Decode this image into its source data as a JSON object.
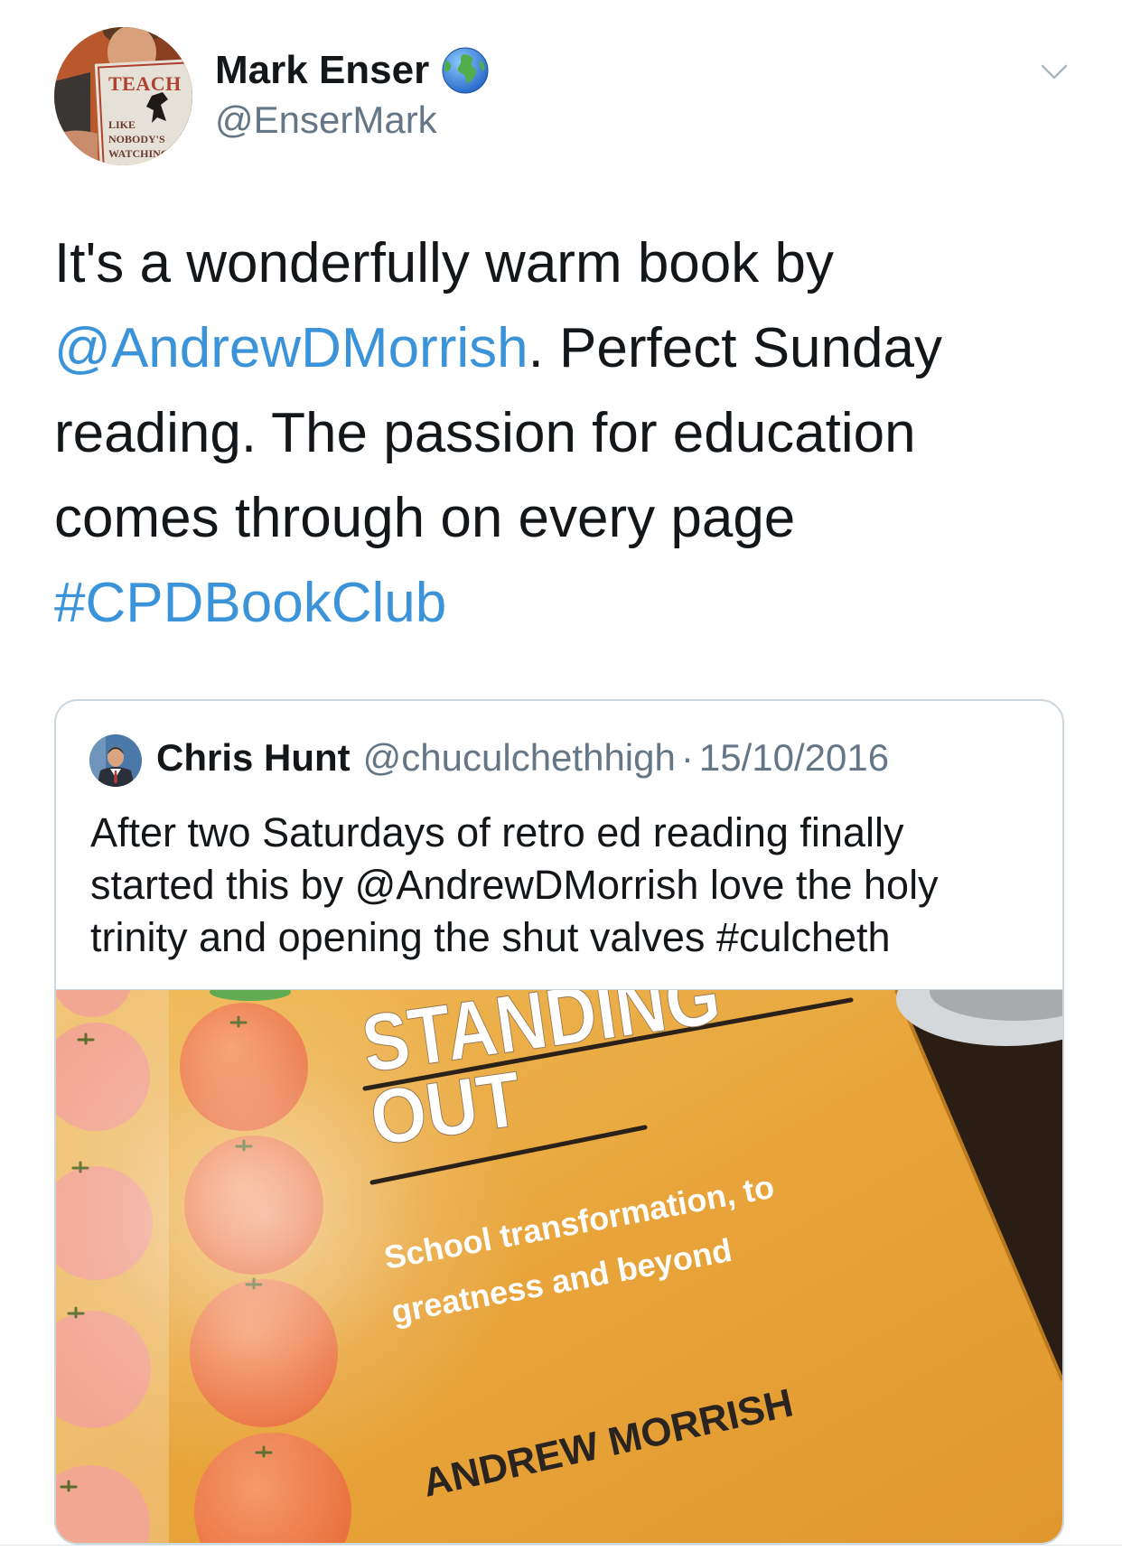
{
  "tweet": {
    "author": {
      "name": "Mark Enser",
      "handle": "@EnserMark",
      "badge_icon": "globe-icon"
    },
    "avatar_book": {
      "line1": "TEACH",
      "line2": "LIKE",
      "line3": "NOBODY'S",
      "line4": "WATCHING"
    },
    "menu_icon": "chevron-down-icon",
    "text": {
      "line1": "It's a wonderfully warm book by",
      "mention": "@AndrewDMorrish",
      "line2_rest": ". Perfect Sunday",
      "line3": "reading. The passion for education",
      "line4": "comes through on every page",
      "hashtag": "#CPDBookClub"
    }
  },
  "quoted": {
    "author": {
      "name": "Chris Hunt",
      "handle": "@chuculchethhigh",
      "separator": "·",
      "date": "15/10/2016"
    },
    "text": {
      "line1": "After two Saturdays of retro ed reading finally",
      "line2": "started this by @AndrewDMorrish love the holy",
      "line3": "trinity and opening the shut valves #culcheth"
    },
    "media": {
      "cover_title_1": "STANDING",
      "cover_title_2": "OUT",
      "cover_subtitle_1": "School transformation, to",
      "cover_subtitle_2": "greatness and beyond",
      "cover_author": "ANDREW MORRISH"
    }
  },
  "colors": {
    "text": "#14171a",
    "secondary": "#657786",
    "link": "#3b94d9",
    "border": "#ccd6dd",
    "cover": "#e8a43a"
  }
}
